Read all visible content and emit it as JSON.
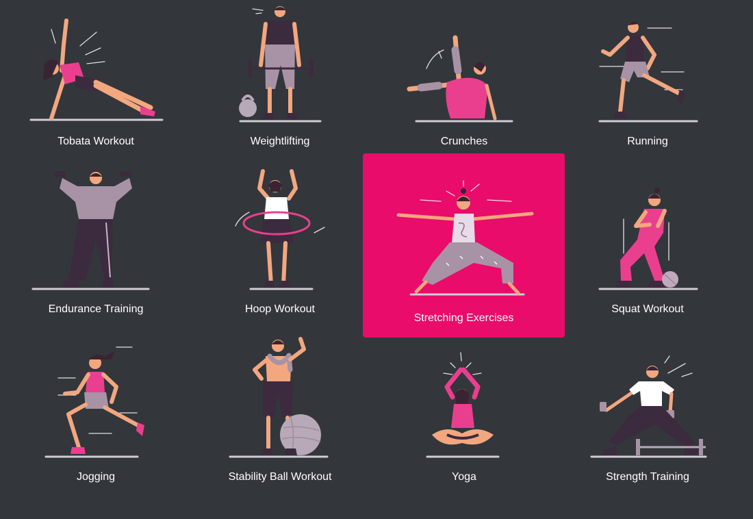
{
  "colors": {
    "background": "#33363b",
    "active_card": "#e90c6b",
    "label": "#ffffff"
  },
  "workouts": [
    {
      "label": "Tobata Workout",
      "icon": "side-plank-figure-icon"
    },
    {
      "label": "Weightlifting",
      "icon": "barbell-lift-figure-icon"
    },
    {
      "label": "Crunches",
      "icon": "crunches-figure-icon"
    },
    {
      "label": "Running",
      "icon": "running-figure-icon"
    },
    {
      "label": "Endurance Training",
      "icon": "dumbbell-press-figure-icon"
    },
    {
      "label": "Hoop Workout",
      "icon": "hula-hoop-figure-icon"
    },
    {
      "label": "Stretching Exercises",
      "icon": "warrior-stretch-figure-icon",
      "selected": true
    },
    {
      "label": "Squat Workout",
      "icon": "squat-figure-icon"
    },
    {
      "label": "Jogging",
      "icon": "jogging-figure-icon"
    },
    {
      "label": "Stability Ball Workout",
      "icon": "stability-ball-figure-icon"
    },
    {
      "label": "Yoga",
      "icon": "yoga-lotus-figure-icon"
    },
    {
      "label": "Strength Training",
      "icon": "lunge-dumbbell-figure-icon"
    }
  ]
}
